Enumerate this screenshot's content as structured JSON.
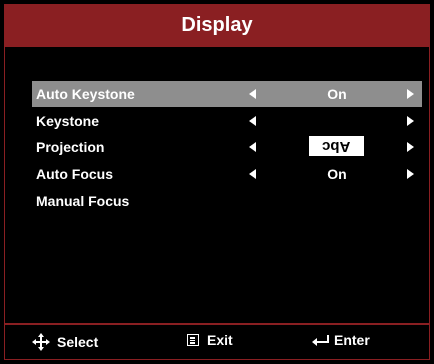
{
  "title": "Display",
  "menu": [
    {
      "label": "Auto Keystone",
      "value": "On",
      "arrows": true,
      "selected": true
    },
    {
      "label": "Keystone",
      "value": "",
      "arrows": true,
      "selected": false
    },
    {
      "label": "Projection",
      "value": "Abc",
      "arrows": true,
      "selected": false,
      "value_style": "inverted-box"
    },
    {
      "label": "Auto Focus",
      "value": "On",
      "arrows": true,
      "selected": false
    },
    {
      "label": "Manual Focus",
      "value": "",
      "arrows": false,
      "selected": false
    }
  ],
  "footer": {
    "select_label": "Select",
    "select_icon": "four-way-arrows-icon",
    "exit_label": "Exit",
    "exit_icon": "menu-icon",
    "enter_label": "Enter",
    "enter_icon": "enter-return-icon"
  },
  "colors": {
    "accent": "#8a1f22",
    "selected_row": "#8e8e8e",
    "background": "#000000",
    "text": "#ffffff"
  }
}
